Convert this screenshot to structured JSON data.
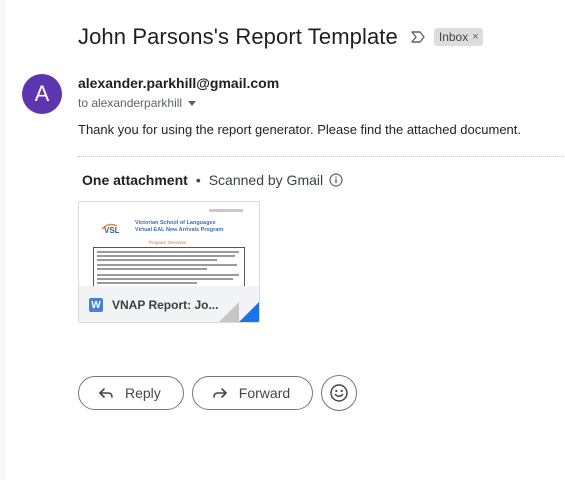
{
  "email": {
    "subject": "John Parsons's Report Template",
    "label_chip": "Inbox",
    "label_remove": "×",
    "avatar_letter": "A",
    "sender": "alexander.parkhill@gmail.com",
    "recipient": "to alexanderparkhill",
    "body": "Thank you for using the report generator. Please find the attached document."
  },
  "attachments": {
    "count_label": "One attachment",
    "separator": "•",
    "scanned_label": "Scanned by Gmail",
    "items": [
      {
        "file_name": "VNAP Report: Jo...",
        "file_type_letter": "W",
        "preview_title_line1": "Victorian School of Languages",
        "preview_title_line2": "Virtual EAL New Arrivals Program",
        "preview_heading": "Program Overview"
      }
    ]
  },
  "actions": {
    "reply_label": "Reply",
    "forward_label": "Forward"
  },
  "colors": {
    "avatar": "#5e35b1",
    "chip_bg": "#dddddd",
    "word_blue": "#4a7fd9",
    "corner_blue": "#1a73e8"
  },
  "icons": {
    "important": "label-important-outline-icon",
    "info": "info-icon",
    "reply": "reply-arrow-icon",
    "forward": "forward-arrow-icon",
    "emoji": "emoji-smile-icon"
  }
}
